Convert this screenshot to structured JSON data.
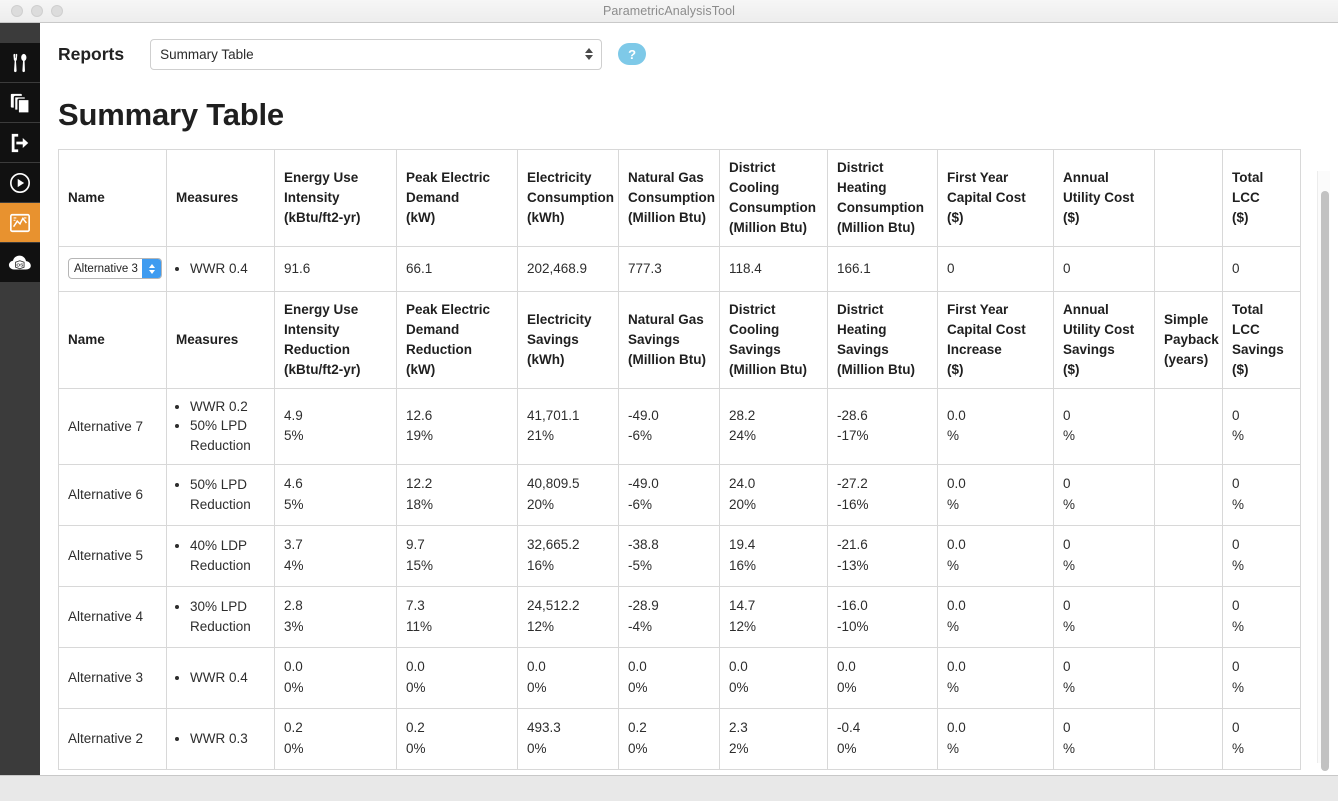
{
  "window": {
    "title": "ParametricAnalysisTool",
    "traffic_lights": [
      "close",
      "minimize",
      "zoom"
    ]
  },
  "sidebar": {
    "items": [
      {
        "id": "tools",
        "icon": "tools-icon",
        "active": false
      },
      {
        "id": "copy",
        "icon": "duplicate-icon",
        "active": false
      },
      {
        "id": "export",
        "icon": "export-icon",
        "active": false
      },
      {
        "id": "run",
        "icon": "play-icon",
        "active": false
      },
      {
        "id": "reports",
        "icon": "chart-icon",
        "active": true
      },
      {
        "id": "cloud",
        "icon": "cloud-os-icon",
        "active": false
      }
    ]
  },
  "toolbar": {
    "reports_label": "Reports",
    "report_select": {
      "value": "Summary Table",
      "options": [
        "Summary Table"
      ]
    },
    "help_label": "?",
    "help_color": "#7ec9e8"
  },
  "report": {
    "title": "Summary Table",
    "baseline_headers": [
      "Name",
      "Measures",
      "Energy Use Intensity\n(kBtu/ft2-yr)",
      "Peak Electric Demand\n(kW)",
      "Electricity Consumption\n(kWh)",
      "Natural Gas Consumption\n(Million Btu)",
      "District Cooling Consumption\n(Million Btu)",
      "District Heating Consumption\n(Million Btu)",
      "First Year Capital Cost\n($)",
      "Annual Utility Cost\n($)",
      "",
      "Total LCC\n($)"
    ],
    "baseline_headers_parts": [
      {
        "main": "Name",
        "unit": ""
      },
      {
        "main": "Measures",
        "unit": ""
      },
      {
        "main": "Energy Use Intensity",
        "unit": "(kBtu/ft2-yr)"
      },
      {
        "main": "Peak Electric Demand",
        "unit": "(kW)"
      },
      {
        "main": "Electricity Consumption",
        "unit": "(kWh)"
      },
      {
        "main": "Natural Gas Consumption",
        "unit": "(Million Btu)"
      },
      {
        "main": "District Cooling Consumption",
        "unit": "(Million Btu)"
      },
      {
        "main": "District Heating Consumption",
        "unit": "(Million Btu)"
      },
      {
        "main": "First Year Capital Cost",
        "unit": "($)"
      },
      {
        "main": "Annual Utility Cost",
        "unit": "($)"
      },
      {
        "main": "",
        "unit": ""
      },
      {
        "main": "Total LCC",
        "unit": "($)"
      }
    ],
    "baseline_row": {
      "name_select": {
        "value": "Alternative 3",
        "options": [
          "Alternative 3"
        ]
      },
      "measures": [
        "WWR 0.4"
      ],
      "values": [
        "91.6",
        "66.1",
        "202,468.9",
        "777.3",
        "118.4",
        "166.1",
        "0",
        "0",
        "",
        "0"
      ]
    },
    "savings_headers_parts": [
      {
        "main": "Name",
        "unit": ""
      },
      {
        "main": "Measures",
        "unit": ""
      },
      {
        "main": "Energy Use Intensity Reduction",
        "unit": "(kBtu/ft2-yr)"
      },
      {
        "main": "Peak Electric Demand Reduction",
        "unit": "(kW)"
      },
      {
        "main": "Electricity Savings",
        "unit": "(kWh)"
      },
      {
        "main": "Natural Gas Savings",
        "unit": "(Million Btu)"
      },
      {
        "main": "District Cooling Savings",
        "unit": "(Million Btu)"
      },
      {
        "main": "District Heating Savings",
        "unit": "(Million Btu)"
      },
      {
        "main": "First Year Capital Cost Increase",
        "unit": "($)"
      },
      {
        "main": "Annual Utility Cost Savings",
        "unit": "($)"
      },
      {
        "main": "Simple Payback",
        "unit": "(years)"
      },
      {
        "main": "Total LCC Savings",
        "unit": "($)"
      }
    ],
    "rows": [
      {
        "name": "Alternative 7",
        "measures": [
          "WWR 0.2",
          "50% LPD Reduction"
        ],
        "cells": [
          {
            "value": "4.9",
            "percent": "5%"
          },
          {
            "value": "12.6",
            "percent": "19%"
          },
          {
            "value": "41,701.1",
            "percent": "21%"
          },
          {
            "value": "-49.0",
            "percent": "-6%"
          },
          {
            "value": "28.2",
            "percent": "24%"
          },
          {
            "value": "-28.6",
            "percent": "-17%"
          },
          {
            "value": "0.0",
            "percent": "%"
          },
          {
            "value": "0",
            "percent": "%"
          },
          {
            "value": "",
            "percent": ""
          },
          {
            "value": "0",
            "percent": "%"
          }
        ]
      },
      {
        "name": "Alternative 6",
        "measures": [
          "50% LPD Reduction"
        ],
        "cells": [
          {
            "value": "4.6",
            "percent": "5%"
          },
          {
            "value": "12.2",
            "percent": "18%"
          },
          {
            "value": "40,809.5",
            "percent": "20%"
          },
          {
            "value": "-49.0",
            "percent": "-6%"
          },
          {
            "value": "24.0",
            "percent": "20%"
          },
          {
            "value": "-27.2",
            "percent": "-16%"
          },
          {
            "value": "0.0",
            "percent": "%"
          },
          {
            "value": "0",
            "percent": "%"
          },
          {
            "value": "",
            "percent": ""
          },
          {
            "value": "0",
            "percent": "%"
          }
        ]
      },
      {
        "name": "Alternative 5",
        "measures": [
          "40% LDP Reduction"
        ],
        "cells": [
          {
            "value": "3.7",
            "percent": "4%"
          },
          {
            "value": "9.7",
            "percent": "15%"
          },
          {
            "value": "32,665.2",
            "percent": "16%"
          },
          {
            "value": "-38.8",
            "percent": "-5%"
          },
          {
            "value": "19.4",
            "percent": "16%"
          },
          {
            "value": "-21.6",
            "percent": "-13%"
          },
          {
            "value": "0.0",
            "percent": "%"
          },
          {
            "value": "0",
            "percent": "%"
          },
          {
            "value": "",
            "percent": ""
          },
          {
            "value": "0",
            "percent": "%"
          }
        ]
      },
      {
        "name": "Alternative 4",
        "measures": [
          "30% LPD Reduction"
        ],
        "cells": [
          {
            "value": "2.8",
            "percent": "3%"
          },
          {
            "value": "7.3",
            "percent": "11%"
          },
          {
            "value": "24,512.2",
            "percent": "12%"
          },
          {
            "value": "-28.9",
            "percent": "-4%"
          },
          {
            "value": "14.7",
            "percent": "12%"
          },
          {
            "value": "-16.0",
            "percent": "-10%"
          },
          {
            "value": "0.0",
            "percent": "%"
          },
          {
            "value": "0",
            "percent": "%"
          },
          {
            "value": "",
            "percent": ""
          },
          {
            "value": "0",
            "percent": "%"
          }
        ]
      },
      {
        "name": "Alternative 3",
        "measures": [
          "WWR 0.4"
        ],
        "cells": [
          {
            "value": "0.0",
            "percent": "0%"
          },
          {
            "value": "0.0",
            "percent": "0%"
          },
          {
            "value": "0.0",
            "percent": "0%"
          },
          {
            "value": "0.0",
            "percent": "0%"
          },
          {
            "value": "0.0",
            "percent": "0%"
          },
          {
            "value": "0.0",
            "percent": "0%"
          },
          {
            "value": "0.0",
            "percent": "%"
          },
          {
            "value": "0",
            "percent": "%"
          },
          {
            "value": "",
            "percent": ""
          },
          {
            "value": "0",
            "percent": "%"
          }
        ]
      },
      {
        "name": "Alternative 2",
        "measures": [
          "WWR 0.3"
        ],
        "cells": [
          {
            "value": "0.2",
            "percent": "0%"
          },
          {
            "value": "0.2",
            "percent": "0%"
          },
          {
            "value": "493.3",
            "percent": "0%"
          },
          {
            "value": "0.2",
            "percent": "0%"
          },
          {
            "value": "2.3",
            "percent": "2%"
          },
          {
            "value": "-0.4",
            "percent": "0%"
          },
          {
            "value": "0.0",
            "percent": "%"
          },
          {
            "value": "0",
            "percent": "%"
          },
          {
            "value": "",
            "percent": ""
          },
          {
            "value": "0",
            "percent": "%"
          }
        ]
      }
    ]
  },
  "scrollbar": {
    "vertical_visible": true
  }
}
